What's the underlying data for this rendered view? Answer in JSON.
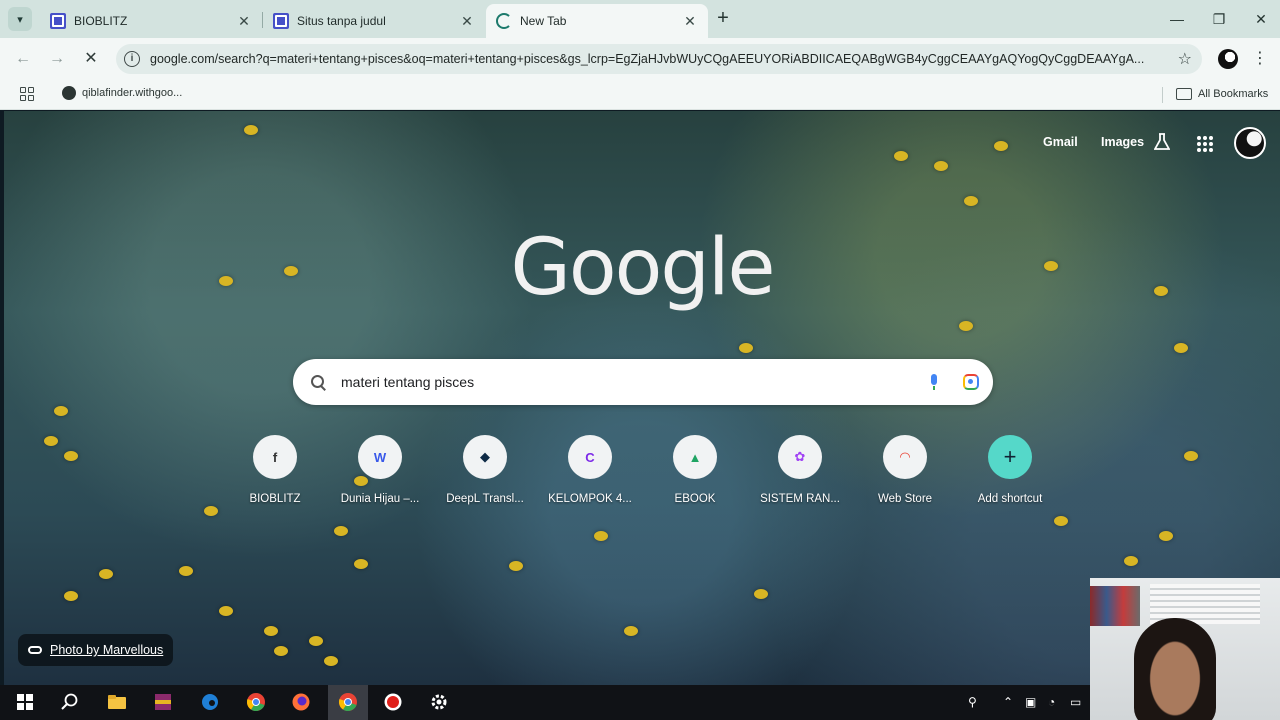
{
  "browser": {
    "tabs": [
      {
        "title": "BIOBLITZ",
        "icon": "google-forms-icon",
        "active": false
      },
      {
        "title": "Situs tanpa judul",
        "icon": "google-forms-icon",
        "active": false
      },
      {
        "title": "New Tab",
        "icon": "loading-spinner-icon",
        "active": true
      }
    ],
    "new_tab_symbol": "+",
    "address": "google.com/search?q=materi+tentang+pisces&oq=materi+tentang+pisces&gs_lcrp=EgZjaHJvbWUyCQgAEEUYORiABDIICAEQABgWGB4yCggCEAAYgAQYogQyCggDEAAYgA...",
    "bookmarks": [
      {
        "label": "qiblafinder.withgoo..."
      }
    ],
    "all_bookmarks": "All Bookmarks"
  },
  "page": {
    "top_links": {
      "gmail": "Gmail",
      "images": "Images"
    },
    "logo": "Google",
    "search_query": "materi tentang pisces",
    "shortcuts": [
      {
        "label": "BIOBLITZ",
        "glyph": "f"
      },
      {
        "label": "Dunia Hijau –...",
        "glyph": "W"
      },
      {
        "label": "DeepL Transl...",
        "glyph": "◆"
      },
      {
        "label": "KELOMPOK 4...",
        "glyph": "C"
      },
      {
        "label": "EBOOK",
        "glyph": "▲"
      },
      {
        "label": "SISTEM RAN...",
        "glyph": "✿"
      },
      {
        "label": "Web Store",
        "glyph": "◠"
      },
      {
        "label": "Add shortcut",
        "glyph": "+"
      }
    ],
    "photo_credit": "Photo by Marvellous"
  },
  "colors": {
    "tabstrip": "#d3e3df",
    "toolbar": "#f3f7f6",
    "add_shortcut": "#55d8c9",
    "flower": "#d8b524"
  }
}
